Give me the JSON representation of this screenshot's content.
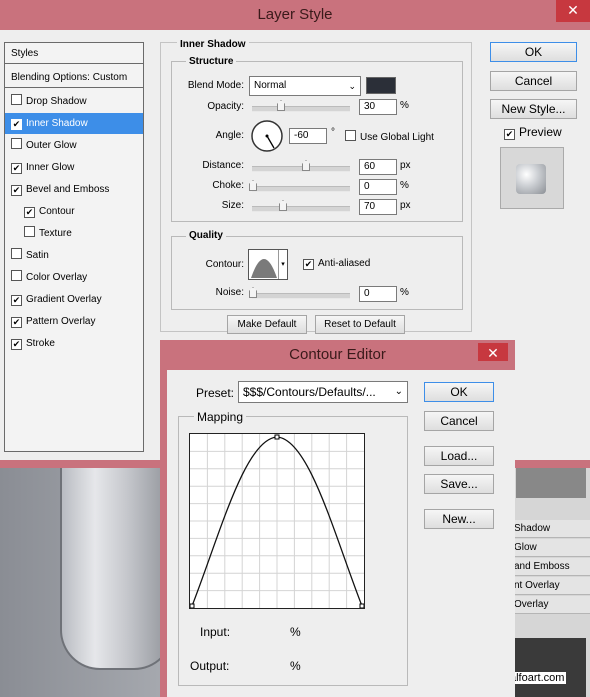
{
  "layer_style": {
    "title": "Layer Style",
    "close": "✕",
    "styles_header": "Styles",
    "blending": "Blending Options: Custom",
    "styles": [
      {
        "label": "Drop Shadow",
        "checked": false
      },
      {
        "label": "Inner Shadow",
        "checked": true
      },
      {
        "label": "Outer Glow",
        "checked": false
      },
      {
        "label": "Inner Glow",
        "checked": true
      },
      {
        "label": "Bevel and Emboss",
        "checked": true
      },
      {
        "label": "Contour",
        "checked": true
      },
      {
        "label": "Texture",
        "checked": false
      },
      {
        "label": "Satin",
        "checked": false
      },
      {
        "label": "Color Overlay",
        "checked": false
      },
      {
        "label": "Gradient Overlay",
        "checked": true
      },
      {
        "label": "Pattern Overlay",
        "checked": true
      },
      {
        "label": "Stroke",
        "checked": true
      }
    ],
    "section_title": "Inner Shadow",
    "structure_label": "Structure",
    "blend_mode_label": "Blend Mode:",
    "blend_mode_value": "Normal",
    "blend_color": "#2b2f38",
    "opacity_label": "Opacity:",
    "opacity_value": "30",
    "opacity_unit": "%",
    "angle_label": "Angle:",
    "angle_value": "-60",
    "angle_unit": "°",
    "global_light_label": "Use Global Light",
    "distance_label": "Distance:",
    "distance_value": "60",
    "distance_unit": "px",
    "choke_label": "Choke:",
    "choke_value": "0",
    "choke_unit": "%",
    "size_label": "Size:",
    "size_value": "70",
    "size_unit": "px",
    "quality_label": "Quality",
    "contour_label": "Contour:",
    "anti_aliased_label": "Anti-aliased",
    "noise_label": "Noise:",
    "noise_value": "0",
    "noise_unit": "%",
    "make_default": "Make Default",
    "reset_default": "Reset to Default",
    "ok": "OK",
    "cancel": "Cancel",
    "new_style": "New Style...",
    "preview": "Preview"
  },
  "contour_editor": {
    "title": "Contour Editor",
    "close": "✕",
    "preset_label": "Preset:",
    "preset_value": "$$$/Contours/Defaults/...",
    "mapping_label": "Mapping",
    "ok": "OK",
    "cancel": "Cancel",
    "load": "Load...",
    "save": "Save...",
    "new": "New...",
    "input_label": "Input:",
    "input_unit": "%",
    "output_label": "Output:",
    "output_unit": "%"
  },
  "background_panel": {
    "rows": [
      "Shadow",
      "Glow",
      "and Emboss",
      "nt Overlay",
      "Overlay"
    ],
    "watermark": "alfoart.com"
  }
}
